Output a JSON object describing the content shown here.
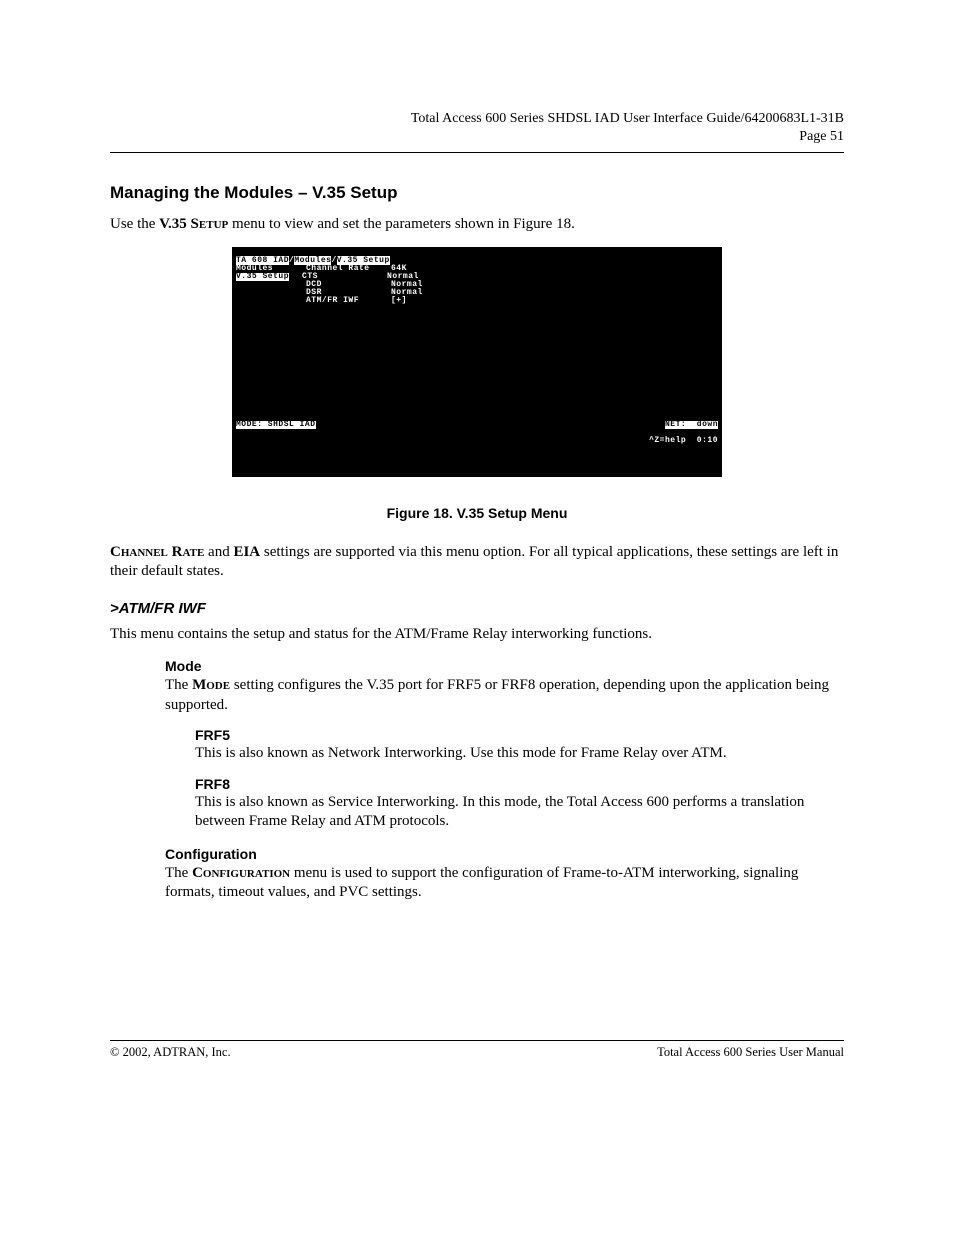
{
  "header": {
    "doc_title": "Total Access 600 Series SHDSL IAD User Interface Guide/64200683L1-31B",
    "page_label": "Page 51"
  },
  "section": {
    "title": "Managing the Modules – V.35 Setup",
    "intro_pre": "Use the ",
    "intro_menu": "V.35 Setup",
    "intro_post": " menu to view and set the parameters shown in Figure 18."
  },
  "terminal": {
    "path_prefix": "TA 608 IAD",
    "path_sep1": "/",
    "path_mid": "Modules",
    "path_sep2": "/",
    "path_end": "V.35 Setup",
    "left_items": [
      "Modules",
      "V.35 Setup"
    ],
    "rows": [
      {
        "label": "Channel Rate",
        "value": "64K"
      },
      {
        "label": "CTS",
        "value": "Normal"
      },
      {
        "label": "DCD",
        "value": "Normal"
      },
      {
        "label": "DSR",
        "value": "Normal"
      },
      {
        "label": "ATM/FR IWF",
        "value": "[+]"
      }
    ],
    "status_mode": "MODE: SHDSL IAD",
    "status_net": "NET:  down",
    "status_help": "^Z=help  0:10"
  },
  "caption": "Figure 18.  V.35 Setup Menu",
  "para_channel": {
    "bold1": "Channel Rate",
    "mid": " and ",
    "bold2": "EIA",
    "rest": " settings are supported via this menu option. For all typical applications, these settings are left in their default states."
  },
  "atmfr": {
    "heading": ">ATM/FR IWF",
    "intro": "This menu contains the setup and status for the ATM/Frame Relay interworking functions.",
    "mode": {
      "heading": "Mode",
      "pre": "The ",
      "bold": "Mode",
      "post": " setting configures the V.35 port for FRF5 or FRF8 operation, depending upon the application being supported."
    },
    "frf5": {
      "heading": "FRF5",
      "body": "This is also known as Network Interworking. Use this mode for Frame Relay over ATM."
    },
    "frf8": {
      "heading": "FRF8",
      "body": "This is also known as Service Interworking. In this mode, the Total Access 600 performs a translation between Frame Relay and ATM protocols."
    },
    "config": {
      "heading": "Configuration",
      "pre": "The ",
      "bold": "Configuration",
      "post": " menu is used to support the configuration of Frame-to-ATM interworking, signaling formats, timeout values, and PVC settings."
    }
  },
  "footer": {
    "left": "© 2002, ADTRAN, Inc.",
    "right": "Total Access 600 Series User Manual"
  }
}
